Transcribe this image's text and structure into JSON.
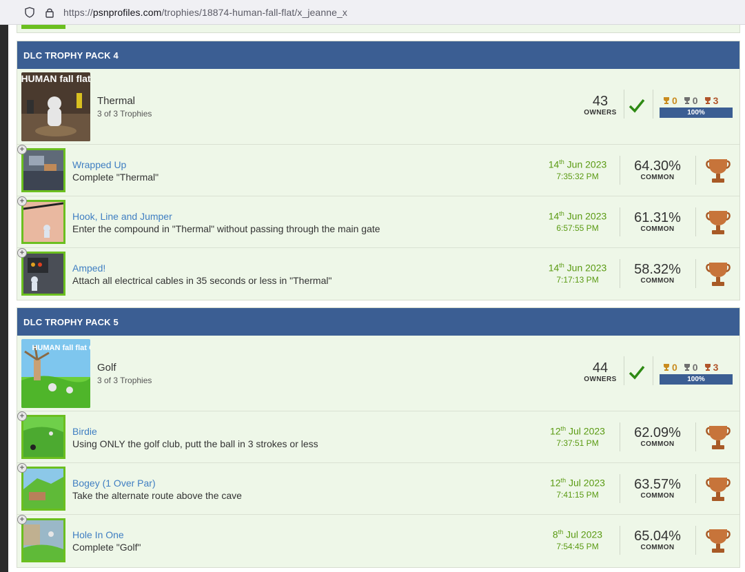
{
  "browser": {
    "url_prefix": "https://",
    "url_host": "psnprofiles.com",
    "url_path": "/trophies/18874-human-fall-flat/x_jeanne_x"
  },
  "colors": {
    "header_bg": "#3b5e93",
    "row_bg": "#eef7e8",
    "accent_green": "#6bbf1f",
    "link": "#3f7ec2",
    "date_green": "#5a9a12"
  },
  "sections": [
    {
      "header": "DLC TROPHY PACK 4",
      "pack": {
        "title": "Thermal",
        "subtitle": "3 of 3 Trophies",
        "owners": "43",
        "owners_label": "OWNERS",
        "gold": "0",
        "silver": "0",
        "bronze": "3",
        "progress": "100%",
        "image_text": "HUMAN fall flat"
      },
      "trophies": [
        {
          "name": "Wrapped Up",
          "desc": "Complete \"Thermal\"",
          "day": "14",
          "suffix": "th",
          "monthyear": " Jun 2023",
          "time": "7:35:32 PM",
          "rate": "64.30%",
          "rarity": "COMMON",
          "trophy_type": "bronze"
        },
        {
          "name": "Hook, Line and Jumper",
          "desc": "Enter the compound in \"Thermal\" without passing through the main gate",
          "day": "14",
          "suffix": "th",
          "monthyear": " Jun 2023",
          "time": "6:57:55 PM",
          "rate": "61.31%",
          "rarity": "COMMON",
          "trophy_type": "bronze"
        },
        {
          "name": "Amped!",
          "desc": "Attach all electrical cables in 35 seconds or less in \"Thermal\"",
          "day": "14",
          "suffix": "th",
          "monthyear": " Jun 2023",
          "time": "7:17:13 PM",
          "rate": "58.32%",
          "rarity": "COMMON",
          "trophy_type": "bronze"
        }
      ]
    },
    {
      "header": "DLC TROPHY PACK 5",
      "pack": {
        "title": "Golf",
        "subtitle": "3 of 3 Trophies",
        "owners": "44",
        "owners_label": "OWNERS",
        "gold": "0",
        "silver": "0",
        "bronze": "3",
        "progress": "100%",
        "image_text": "HUMAN fall flat GOLF"
      },
      "trophies": [
        {
          "name": "Birdie",
          "desc": "Using ONLY the golf club, putt the ball in 3 strokes or less",
          "day": "12",
          "suffix": "th",
          "monthyear": " Jul 2023",
          "time": "7:37:51 PM",
          "rate": "62.09%",
          "rarity": "COMMON",
          "trophy_type": "bronze"
        },
        {
          "name": "Bogey (1 Over Par)",
          "desc": "Take the alternate route above the cave",
          "day": "12",
          "suffix": "th",
          "monthyear": " Jul 2023",
          "time": "7:41:15 PM",
          "rate": "63.57%",
          "rarity": "COMMON",
          "trophy_type": "bronze"
        },
        {
          "name": "Hole In One",
          "desc": "Complete \"Golf\"",
          "day": "8",
          "suffix": "th",
          "monthyear": " Jul 2023",
          "time": "7:54:45 PM",
          "rate": "65.04%",
          "rarity": "COMMON",
          "trophy_type": "bronze"
        }
      ]
    }
  ]
}
